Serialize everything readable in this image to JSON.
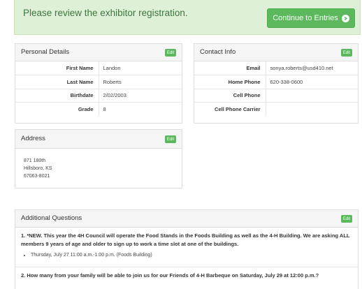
{
  "banner": {
    "message": "Please review the exhibitor registration.",
    "continue_label": "Continue to Entries",
    "color_bg": "#dff0d8",
    "color_button": "#5cb85c"
  },
  "personal": {
    "title": "Personal Details",
    "edit_label": "Edit",
    "rows": [
      {
        "label": "First Name",
        "value": "Landon"
      },
      {
        "label": "Last Name",
        "value": "Roberts"
      },
      {
        "label": "Birthdate",
        "value": "2/02/2003"
      },
      {
        "label": "Grade",
        "value": "8"
      }
    ]
  },
  "contact": {
    "title": "Contact Info",
    "edit_label": "Edit",
    "rows": [
      {
        "label": "Email",
        "value": "sonya.roberts@usd410.net"
      },
      {
        "label": "Home Phone",
        "value": "620-338-0600"
      },
      {
        "label": "Cell Phone",
        "value": ""
      },
      {
        "label": "Cell Phone Carrier",
        "value": ""
      }
    ]
  },
  "address": {
    "title": "Address",
    "edit_label": "Edit",
    "lines": [
      "871 180th",
      "Hillsboro, KS",
      "67063-8021"
    ]
  },
  "additional": {
    "title": "Additional Questions",
    "edit_label": "Edit",
    "questions": [
      {
        "text": "1. *NEW. This year the 4H Council will operate the Food Stands in the Foods Building as well as the 4-H Building. We are asking ALL members 9 years of age and older to sign up to work a time slot at one of the buildings.",
        "answer": "Thursday, July 27 11:00 a.m.-1:00 p.m. (Foods Building)"
      },
      {
        "text": "2. How many from your family will be able to join us for our Friends of 4-H Barbeque on Saturday, July 29 at 12:00 p.m.?",
        "answer": ""
      }
    ]
  }
}
